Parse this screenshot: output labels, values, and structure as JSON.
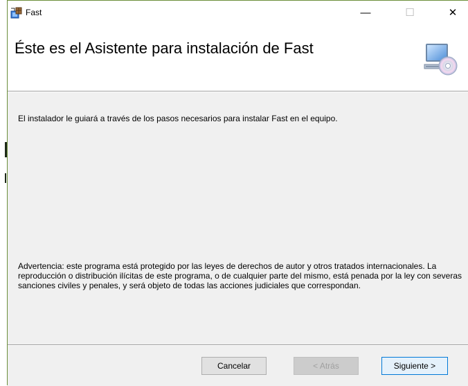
{
  "window": {
    "title": "Fast",
    "minimize_glyph": "—",
    "maximize_glyph": "☐",
    "close_glyph": "✕",
    "app_icon": "installer-package-icon",
    "accent_border": "#6b8e3a"
  },
  "header": {
    "title": "Éste es el Asistente para instalación de Fast",
    "icon": "computer-cd-icon"
  },
  "body": {
    "intro": "El instalador le guiará a través de los pasos necesarios para instalar Fast en el equipo.",
    "warning": "Advertencia: este programa está protegido por las leyes de derechos de autor y otros tratados internacionales. La reproducción o distribución ilícitas de este programa, o de cualquier parte del mismo, está penada por la ley con severas sanciones civiles y penales, y será objeto de todas las acciones judiciales que correspondan."
  },
  "buttons": {
    "cancel": "Cancelar",
    "back": "< Atrás",
    "next": "Siguiente >"
  }
}
